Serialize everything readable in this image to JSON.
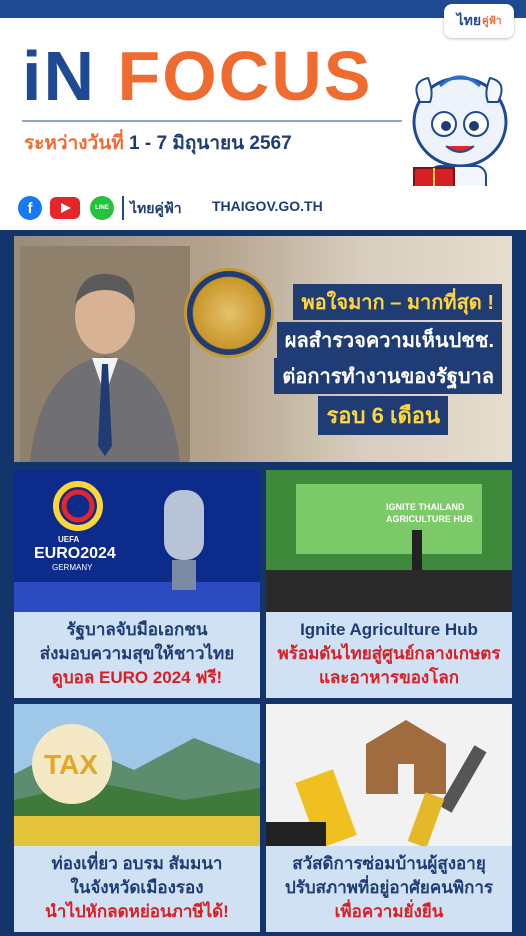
{
  "brand": {
    "logo_main": "ไทย",
    "logo_sub": "คู่ฟ้า"
  },
  "header": {
    "title_part1": "iN",
    "title_part2": "FOCUS",
    "date_prefix": "ระหว่างวันที่",
    "date_range": "1 - 7 มิถุนายน 2567"
  },
  "social": {
    "facebook_glyph": "f",
    "line_glyph": "LINE",
    "name": "ไทยคู่ฟ้า",
    "website": "THAIGOV.GO.TH"
  },
  "hero": {
    "line1": "พอใจมาก – มากที่สุด !",
    "line2": "ผลสำรวจความเห็นปชช.",
    "line3": "ต่อการทำงานของรัฐบาล",
    "line4": "รอบ 6 เดือน"
  },
  "cards": [
    {
      "lines": [
        "รัฐบาลจับมือเอกชน",
        "ส่งมอบความสุขให้ชาวไทย",
        "ดูบอล EURO 2024 ฟรี!"
      ],
      "image_text": [
        "UEFA",
        "EURO2024",
        "GERMANY"
      ]
    },
    {
      "lines": [
        "Ignite Agriculture Hub",
        "พร้อมดันไทยสู่ศูนย์กลางเกษตร",
        "และอาหารของโลก"
      ],
      "image_text": [
        "IGNITE THAILAND",
        "AGRICULTURE HUB"
      ]
    },
    {
      "lines": [
        "ท่องเที่ยว อบรม สัมมนา",
        "ในจังหวัดเมืองรอง",
        "นำไปหักลดหย่อนภาษีได้!"
      ],
      "image_text": [
        "TAX"
      ]
    },
    {
      "lines": [
        "สวัสดิการซ่อมบ้านผู้สูงอายุ",
        "ปรับสภาพที่อยู่อาศัยคนพิการ",
        "เพื่อความยั่งยืน"
      ],
      "image_text": []
    }
  ],
  "colors": {
    "navy": "#1f3d74",
    "orange": "#ef6b2f",
    "red": "#d91f26",
    "yellow": "#ffd63a",
    "panel": "#cfe1f3"
  }
}
